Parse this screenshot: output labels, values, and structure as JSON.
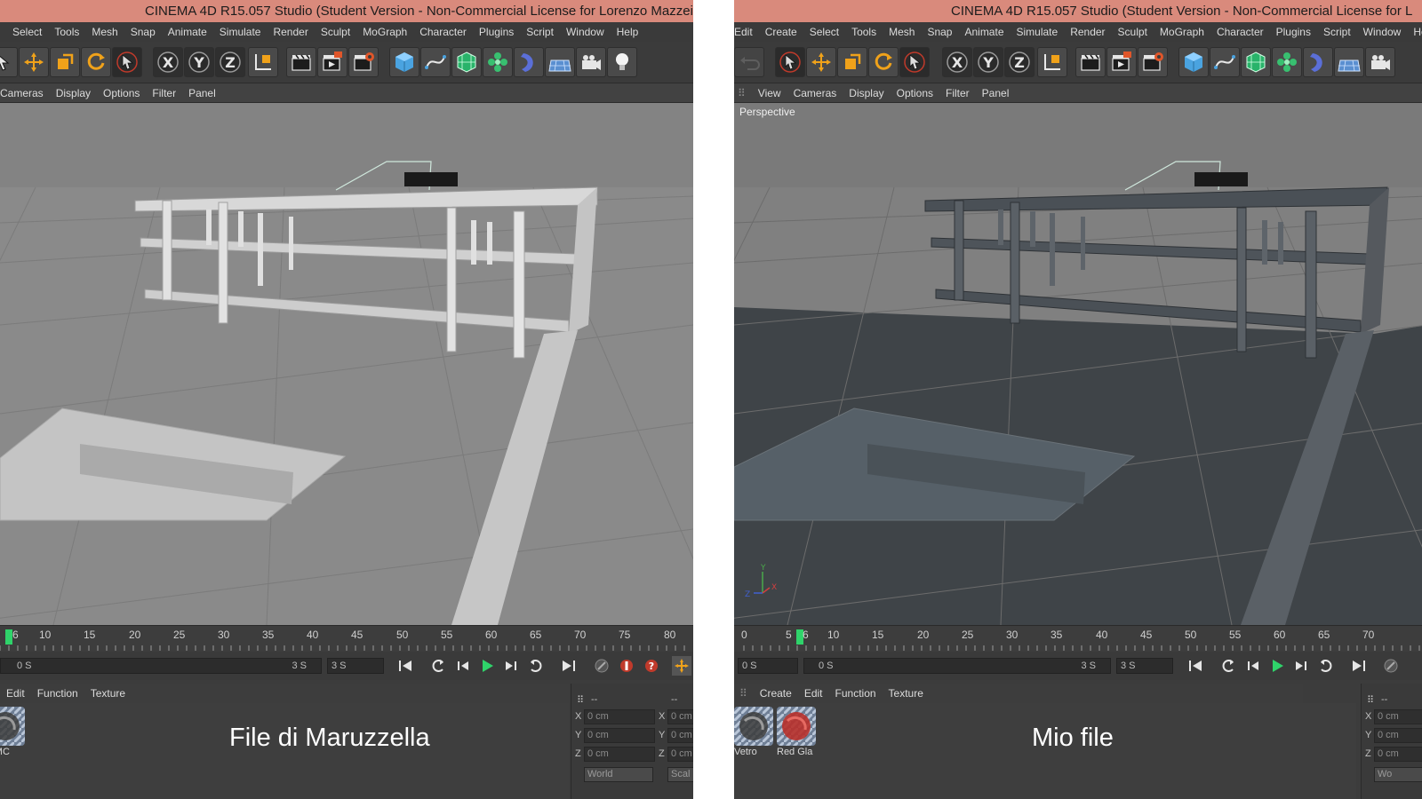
{
  "colors": {
    "title_bar": "#d98a7c",
    "panel": "#3c3c3c",
    "accent_orange": "#f0a21a",
    "playhead_green": "#2fd36a"
  },
  "left": {
    "title": "CINEMA 4D R15.057 Studio (Student Version - Non-Commercial License for Lorenzo Mazzei at",
    "menu": [
      "Select",
      "Tools",
      "Mesh",
      "Snap",
      "Animate",
      "Simulate",
      "Render",
      "Sculpt",
      "MoGraph",
      "Character",
      "Plugins",
      "Script",
      "Window",
      "Help"
    ],
    "viewport_menu": [
      "Cameras",
      "Display",
      "Options",
      "Filter",
      "Panel"
    ],
    "timeline_ticks": [
      "6",
      "10",
      "15",
      "20",
      "25",
      "30",
      "35",
      "40",
      "45",
      "50",
      "55",
      "60",
      "65",
      "70",
      "75",
      "80"
    ],
    "range_start": "0 S",
    "range_end": "3 S",
    "max_field": "3 S",
    "material_menu": [
      "Edit",
      "Function",
      "Texture"
    ],
    "materials": [
      {
        "name": "tr MC",
        "icon": "glass-material-icon"
      }
    ],
    "coords": {
      "x": "0 cm",
      "y": "0 cm",
      "z": "0 cm",
      "x2": "0 cm",
      "y2": "0 cm",
      "z2": "0 cm",
      "world": "World",
      "scale": "Scal"
    },
    "caption": "File di Maruzzella"
  },
  "right": {
    "title": "CINEMA 4D R15.057 Studio (Student Version - Non-Commercial License for L",
    "menu": [
      "Edit",
      "Create",
      "Select",
      "Tools",
      "Mesh",
      "Snap",
      "Animate",
      "Simulate",
      "Render",
      "Sculpt",
      "MoGraph",
      "Character",
      "Plugins",
      "Script",
      "Window",
      "Help"
    ],
    "viewport_menu": [
      "View",
      "Cameras",
      "Display",
      "Options",
      "Filter",
      "Panel"
    ],
    "viewport_label": "Perspective",
    "timeline_ticks": [
      "0",
      "5",
      "6",
      "10",
      "15",
      "20",
      "25",
      "30",
      "35",
      "40",
      "45",
      "50",
      "55",
      "60",
      "65",
      "70"
    ],
    "current_field": "0 S",
    "range_start": "0 S",
    "range_end": "3 S",
    "max_field": "3 S",
    "material_menu": [
      "Create",
      "Edit",
      "Function",
      "Texture"
    ],
    "materials": [
      {
        "name": "Vetro",
        "icon": "glass-material-icon"
      },
      {
        "name": "Red Gla",
        "icon": "red-glass-material-icon"
      }
    ],
    "coords": {
      "x": "0 cm",
      "y": "0 cm",
      "z": "0 cm",
      "world": "Wo"
    },
    "caption": "Mio file"
  }
}
